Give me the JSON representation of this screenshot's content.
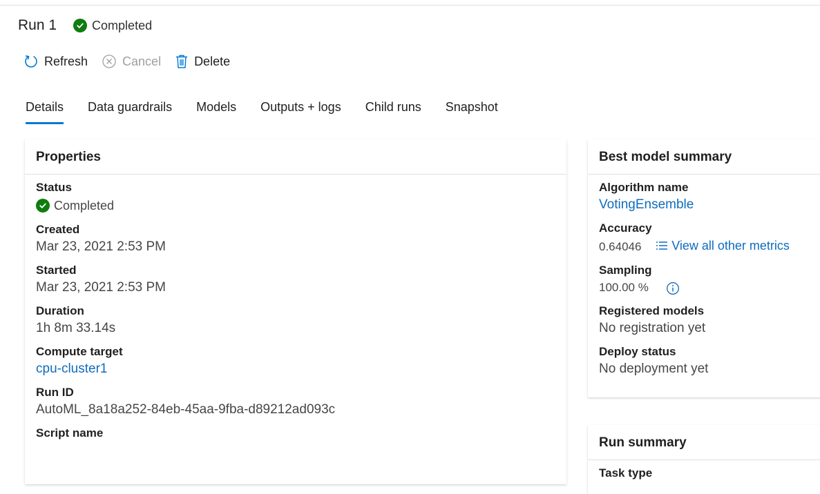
{
  "header": {
    "run_title": "Run 1",
    "status": "Completed",
    "status_color": "#107c10"
  },
  "toolbar": {
    "refresh_label": "Refresh",
    "cancel_label": "Cancel",
    "delete_label": "Delete",
    "accent": "#0078d4"
  },
  "tabs": [
    {
      "label": "Details",
      "active": true
    },
    {
      "label": "Data guardrails"
    },
    {
      "label": "Models"
    },
    {
      "label": "Outputs + logs"
    },
    {
      "label": "Child runs"
    },
    {
      "label": "Snapshot"
    }
  ],
  "properties": {
    "title": "Properties",
    "status_label": "Status",
    "status_value": "Completed",
    "created_label": "Created",
    "created_value": "Mar 23, 2021 2:53 PM",
    "started_label": "Started",
    "started_value": "Mar 23, 2021 2:53 PM",
    "duration_label": "Duration",
    "duration_value": "1h 8m 33.14s",
    "compute_label": "Compute target",
    "compute_value": "cpu-cluster1",
    "runid_label": "Run ID",
    "runid_value": "AutoML_8a18a252-84eb-45aa-9fba-d89212ad093c",
    "script_label": "Script name"
  },
  "best_model": {
    "title": "Best model summary",
    "algorithm_label": "Algorithm name",
    "algorithm_value": "VotingEnsemble",
    "accuracy_label": "Accuracy",
    "accuracy_value": "0.64046",
    "metrics_link": "View all other metrics",
    "sampling_label": "Sampling",
    "sampling_value": "100.00 %",
    "registered_label": "Registered models",
    "registered_value": "No registration yet",
    "deploy_label": "Deploy status",
    "deploy_value": "No deployment yet"
  },
  "run_summary": {
    "title": "Run summary",
    "task_type_label": "Task type"
  }
}
